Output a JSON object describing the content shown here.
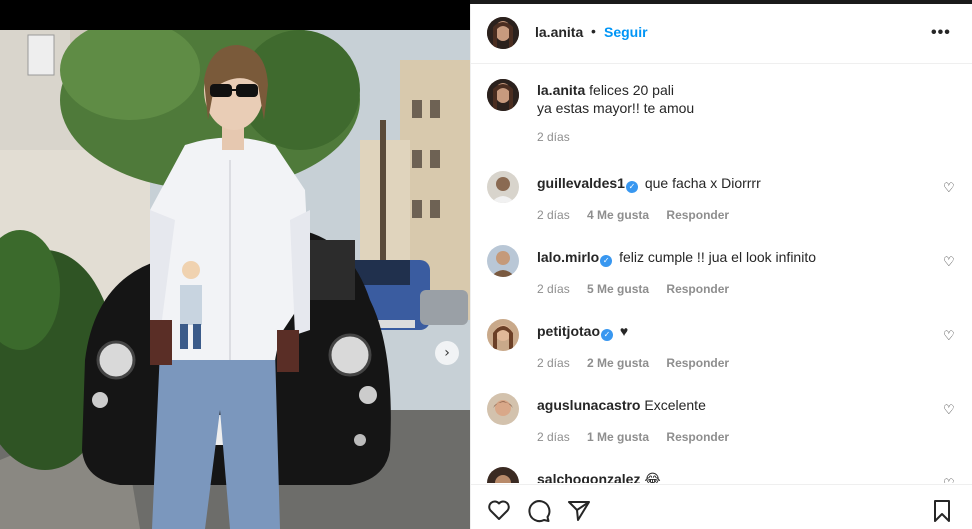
{
  "post": {
    "author": "la.anita",
    "follow_label": "Seguir",
    "separator": "•",
    "more_label": "•••",
    "next_label": "›"
  },
  "caption": {
    "username": "la.anita",
    "line1": "felices 20 pali",
    "line2": "ya estas mayor!! te amou",
    "time": "2 días"
  },
  "comments": [
    {
      "username": "guillevaldes1",
      "verified": true,
      "text": "que facha x Diorrrr",
      "time": "2 días",
      "likes": "4 Me gusta",
      "reply": "Responder"
    },
    {
      "username": "lalo.mirlo",
      "verified": true,
      "text": "feliz cumple !! jua el look infinito",
      "time": "2 días",
      "likes": "5 Me gusta",
      "reply": "Responder"
    },
    {
      "username": "petitjotao",
      "verified": true,
      "text": "♥",
      "time": "2 días",
      "likes": "2 Me gusta",
      "reply": "Responder"
    },
    {
      "username": "aguslunacastro",
      "verified": false,
      "text": "Excelente",
      "time": "2 días",
      "likes": "1 Me gusta",
      "reply": "Responder"
    },
    {
      "username": "salchogonzalez",
      "verified": false,
      "text": "😂",
      "time": "",
      "likes": "",
      "reply": ""
    }
  ],
  "icons": {
    "verified": "✓",
    "comment_like": "♡"
  },
  "colors": {
    "accent": "#0095f6",
    "verified": "#3897f0",
    "secondary_text": "#8e8e8e"
  }
}
